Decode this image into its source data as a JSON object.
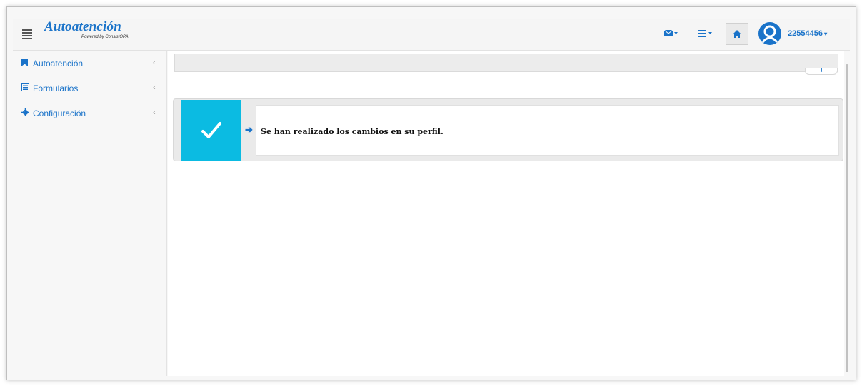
{
  "header": {
    "brand_title": "Autoatención",
    "brand_subtitle": "Powered by ConsistOPA",
    "icons": [
      "hamburger-icon",
      "mail-icon",
      "list-icon",
      "home-icon",
      "user-avatar-icon"
    ],
    "user_id": "22554456"
  },
  "sidebar": {
    "items": [
      {
        "label": "Autoatención",
        "icon": "bookmark-icon"
      },
      {
        "label": "Formularios",
        "icon": "form-icon"
      },
      {
        "label": "Configuración",
        "icon": "gear-icon"
      }
    ]
  },
  "alert": {
    "message": "Se han realizado los cambios en su perfil.",
    "icon": "checkmark-icon"
  },
  "colors": {
    "accent": "#1a73c9",
    "success_panel": "#0bbbe2"
  }
}
